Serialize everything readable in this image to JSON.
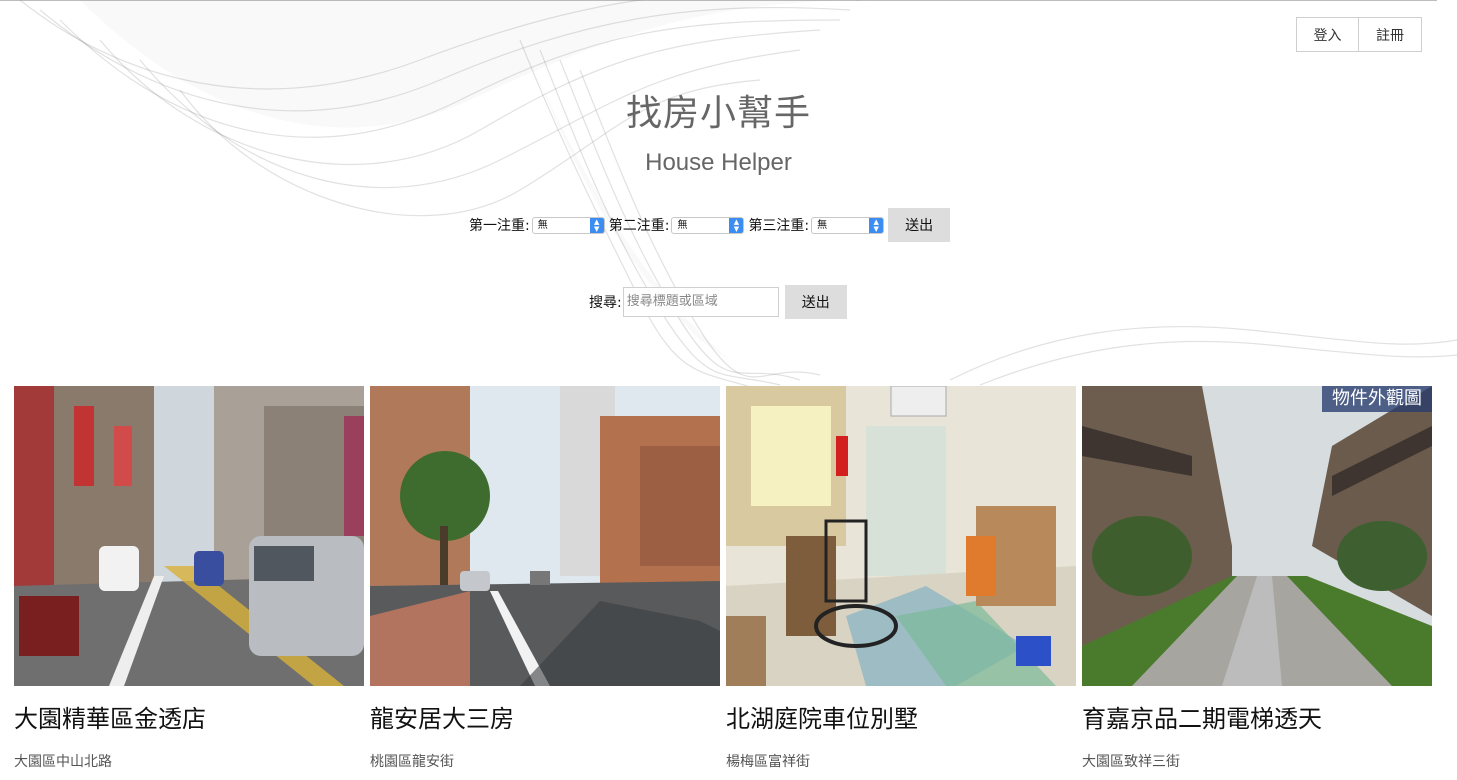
{
  "auth": {
    "login_label": "登入",
    "register_label": "註冊"
  },
  "header": {
    "title_zh": "找房小幫手",
    "title_en": "House Helper"
  },
  "preferences": {
    "first_label": "第一注重:",
    "second_label": "第二注重:",
    "third_label": "第三注重:",
    "first_value": "無",
    "second_value": "無",
    "third_value": "無",
    "submit_label": "送出"
  },
  "search": {
    "label": "搜尋:",
    "placeholder": "搜尋標題或區域",
    "submit_label": "送出"
  },
  "listings": [
    {
      "title": "大園精華區金透店",
      "address": "大園區中山北路",
      "badge": ""
    },
    {
      "title": "龍安居大三房",
      "address": "桃園區龍安街",
      "badge": ""
    },
    {
      "title": "北湖庭院車位別墅",
      "address": "楊梅區富祥街",
      "badge": ""
    },
    {
      "title": "育嘉京品二期電梯透天",
      "address": "大園區致祥三街",
      "badge": "物件外觀圖"
    }
  ],
  "colors": {
    "select_arrow": "#3b8df2",
    "button_bg": "#dddddd"
  }
}
